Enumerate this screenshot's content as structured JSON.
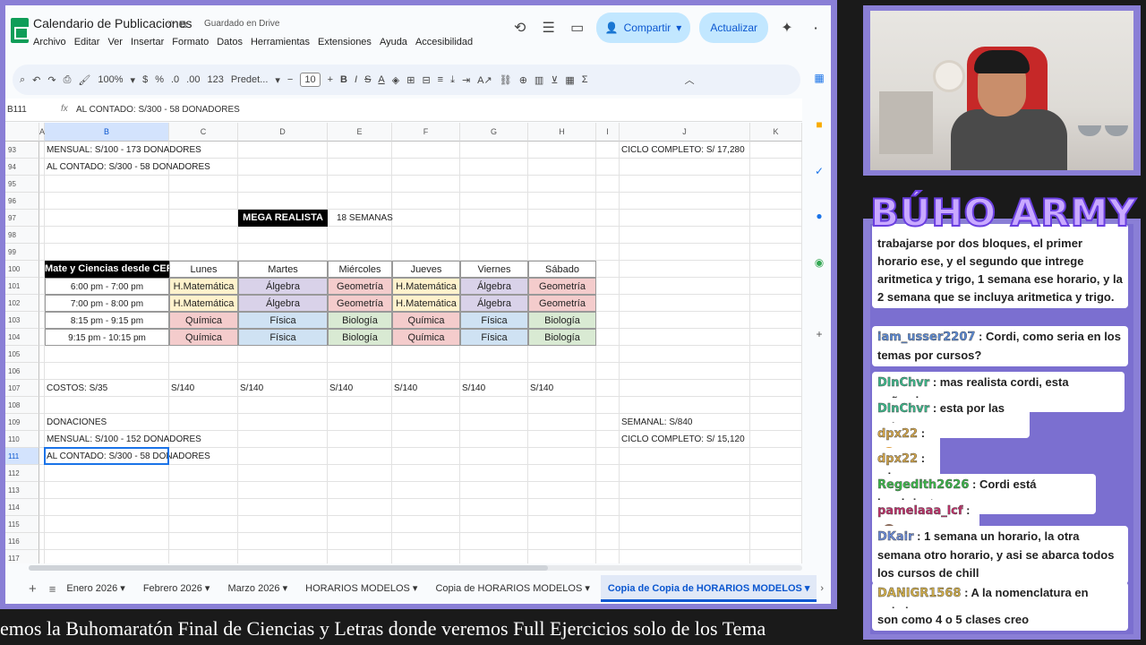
{
  "sheets": {
    "doc_title": "Calendario de Publicaciones",
    "saved_status": "Guardado en Drive",
    "menu": [
      "Archivo",
      "Editar",
      "Ver",
      "Insertar",
      "Formato",
      "Datos",
      "Herramientas",
      "Extensiones",
      "Ayuda",
      "Accesibilidad"
    ],
    "share_label": "Compartir",
    "update_label": "Actualizar",
    "toolbar": {
      "zoom": "100%",
      "currency": "$",
      "percent": "%",
      "dec_less": ".0",
      "dec_more": ".00",
      "num_format": "123",
      "font": "Predet...",
      "font_size": "10"
    },
    "formula_bar": {
      "cell_ref": "B111",
      "fx": "fx",
      "content": "AL CONTADO: S/300 -  58 DONADORES"
    },
    "columns": [
      "A",
      "B",
      "C",
      "D",
      "E",
      "F",
      "G",
      "H",
      "I",
      "J",
      "K"
    ],
    "rows": [
      "93",
      "94",
      "95",
      "96",
      "97",
      "98",
      "99",
      "100",
      "101",
      "102",
      "103",
      "104",
      "105",
      "106",
      "107",
      "108",
      "109",
      "110",
      "111",
      "112",
      "113",
      "114",
      "115",
      "116",
      "117"
    ],
    "cells": {
      "r93_b": "MENSUAL: S/100 -  173 DONADORES",
      "r93_j": "CICLO COMPLETO: S/ 17,280",
      "r94_b": "AL CONTADO: S/300 -  58 DONADORES",
      "r97_mega": "MEGA REALISTA",
      "r97_weeks": "18 SEMANAS",
      "r100_title": "Mate y Ciencias desde CERO",
      "days": [
        "Lunes",
        "Martes",
        "Miércoles",
        "Jueves",
        "Viernes",
        "Sábado"
      ],
      "slots": [
        "6:00 pm - 7:00 pm",
        "7:00 pm - 8:00 pm",
        "8:15 pm - 9:15 pm",
        "9:15 pm - 10:15 pm"
      ],
      "schedule": [
        [
          "H.Matemática",
          "Álgebra",
          "Geometría",
          "H.Matemática",
          "Álgebra",
          "Geometría"
        ],
        [
          "H.Matemática",
          "Álgebra",
          "Geometría",
          "H.Matemática",
          "Álgebra",
          "Geometría"
        ],
        [
          "Química",
          "Física",
          "Biología",
          "Química",
          "Física",
          "Biología"
        ],
        [
          "Química",
          "Física",
          "Biología",
          "Química",
          "Física",
          "Biología"
        ]
      ],
      "r107_costos": "COSTOS: S/35",
      "r107_prices": [
        "S/140",
        "S/140",
        "S/140",
        "S/140",
        "S/140",
        "S/140"
      ],
      "r109_b": "DONACIONES",
      "r109_j": "SEMANAL: S/840",
      "r110_b": "MENSUAL: S/100 -  152 DONADORES",
      "r110_j": "CICLO COMPLETO: S/ 15,120",
      "r111_b": "AL CONTADO: S/300 -  58 DONADORES"
    },
    "tabs": [
      "Enero 2026",
      "Febrero 2026",
      "Marzo 2026",
      "HORARIOS MODELOS",
      "Copia de HORARIOS MODELOS",
      "Copia de Copia de HORARIOS MODELOS"
    ],
    "active_tab": 5
  },
  "ticker": "emos la Buhomaratón Final de Ciencias y Letras donde veremos Full Ejercicios solo de los Tema",
  "brand": "BÚHO ARMY",
  "chat": [
    {
      "user": "",
      "text": "trabajarse por dos bloques, el primer horario ese, y el segundo que intrege aritmetica y trigo, 1 semana ese horario, y la 2 semana que se incluya aritmetica y trigo.",
      "color": "#5b8ad6"
    },
    {
      "user": "iam_usser2207",
      "text": ": Cordi, como seria en los temas por cursos?",
      "color": "#5b8ad6"
    },
    {
      "user": "DlnChvr",
      "text": ": mas realista cordi, esta soñando",
      "color": "#3cb88a"
    },
    {
      "user": "DlnChvr",
      "text": ": esta por las nubes",
      "color": "#3cb88a"
    },
    {
      "user": "dpx22",
      "text": ":",
      "color": "#d4a64a"
    },
    {
      "user": "dpx22",
      "text": ": xd",
      "color": "#d4a64a"
    },
    {
      "user": "Regedith2626",
      "text": ": Cordi está hambriento",
      "color": "#3cb84a"
    },
    {
      "user": "pamelaaa_lcf",
      "text": ":",
      "color": "#c0306a"
    },
    {
      "user": "DKair",
      "text": ": 1 semana un horario, la otra semana otro horario, y asi se abarca todos los cursos de chill",
      "color": "#6a8ad6"
    },
    {
      "user": "DANIGR1568",
      "text": ": A la nomenclatura en quimica",
      "color": "#d4b04a"
    },
    {
      "user": "",
      "text": "son como 4 o 5 clases creo",
      "color": "#222"
    }
  ],
  "colors": {
    "accent": "#0b57d0",
    "frame": "#8a7fd6",
    "yellow": "#fff2cc",
    "purple": "#d9d2e9",
    "pink": "#f4cccc",
    "blue": "#cfe2f3",
    "green": "#d9ead3"
  }
}
